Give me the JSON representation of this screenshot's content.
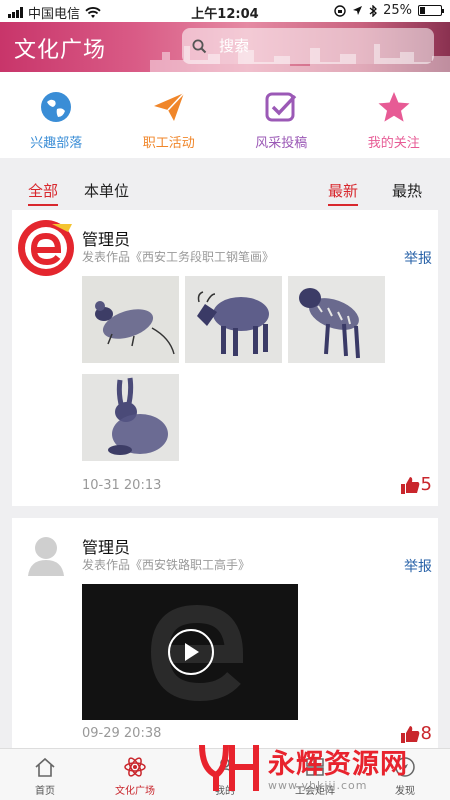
{
  "status_bar": {
    "carrier": "中国电信",
    "time": "上午12:04",
    "battery": "25%",
    "battery_level": 0.25
  },
  "header": {
    "title": "文化广场",
    "search_placeholder": "搜索"
  },
  "quick_menu": [
    {
      "label": "兴趣部落",
      "icon": "globe-icon",
      "color": "#3a8dd6"
    },
    {
      "label": "职工活动",
      "icon": "paper-plane-icon",
      "color": "#f0862a"
    },
    {
      "label": "风采投稿",
      "icon": "checkbox-edit-icon",
      "color": "#9b59b6"
    },
    {
      "label": "我的关注",
      "icon": "star-icon",
      "color": "#e75b95"
    }
  ],
  "tabs": {
    "all": "全部",
    "unit": "本单位",
    "newest": "最新",
    "hottest": "最热"
  },
  "posts": [
    {
      "user": "管理员",
      "subline": "发表作品《西安工务段职工钢笔画》",
      "report": "举报",
      "images": [
        "mouse-sketch",
        "ox-sketch",
        "tiger-sketch",
        "rabbit-sketch"
      ],
      "time": "10-31 20:13",
      "likes": "5"
    },
    {
      "user": "管理员",
      "subline": "发表作品《西安铁路职工高手》",
      "report": "举报",
      "time": "09-29 20:38",
      "likes": "8"
    }
  ],
  "bottom_nav": [
    {
      "label": "首页",
      "icon": "home-icon"
    },
    {
      "label": "文化广场",
      "icon": "atom-icon"
    },
    {
      "label": "我的",
      "icon": "user-icon"
    },
    {
      "label": "工会矩阵",
      "icon": "grid-icon"
    },
    {
      "label": "发现",
      "icon": "compass-icon"
    }
  ],
  "watermark": {
    "text": "永辉资源网",
    "url": "www.yhkjjj.com"
  }
}
